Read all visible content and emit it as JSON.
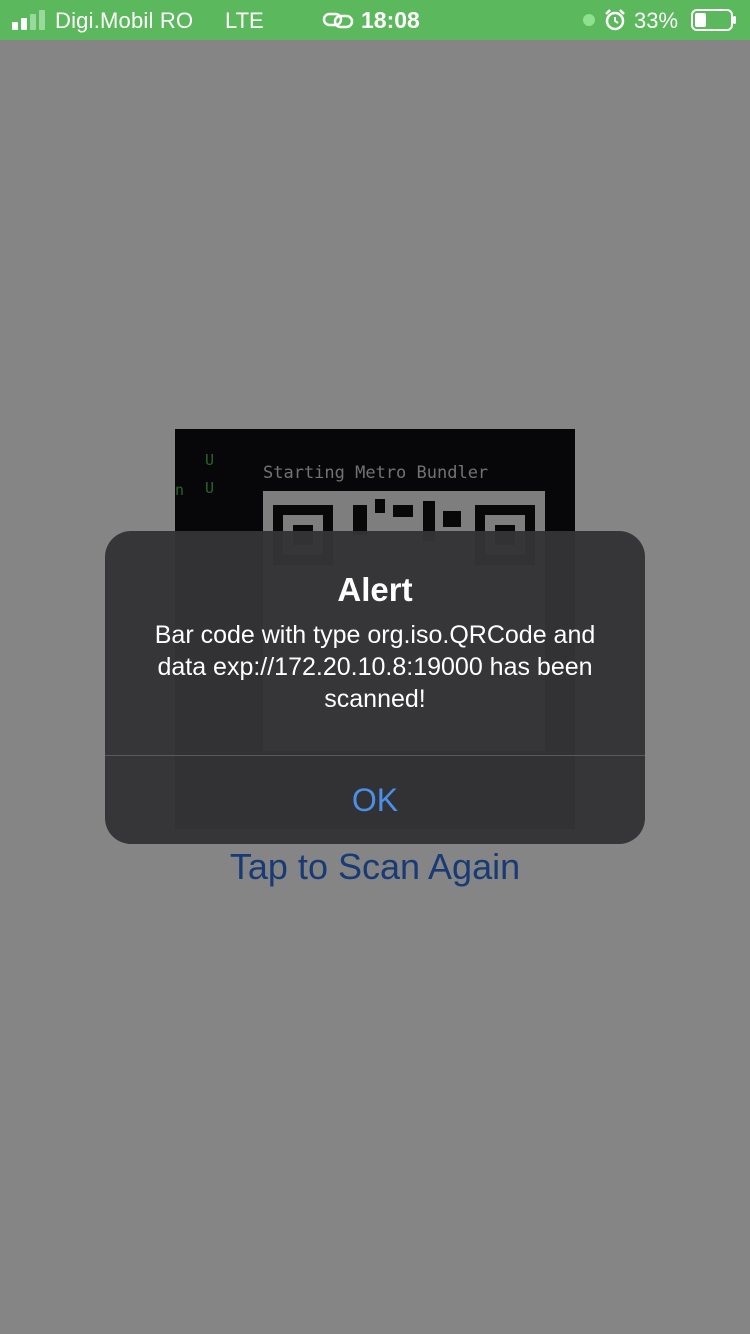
{
  "status_bar": {
    "carrier": "Digi.Mobil RO",
    "network": "LTE",
    "time": "18:08",
    "battery_percent": "33%",
    "background_color": "#5cb85c"
  },
  "camera_preview": {
    "text_line": "Starting Metro Bundler"
  },
  "main": {
    "tap_again_label": "Tap to Scan Again"
  },
  "alert": {
    "title": "Alert",
    "message": "Bar code with type org.iso.QRCode and data exp://172.20.10.8:19000 has been scanned!",
    "ok_label": "OK",
    "accent_color": "#4a90e8"
  }
}
